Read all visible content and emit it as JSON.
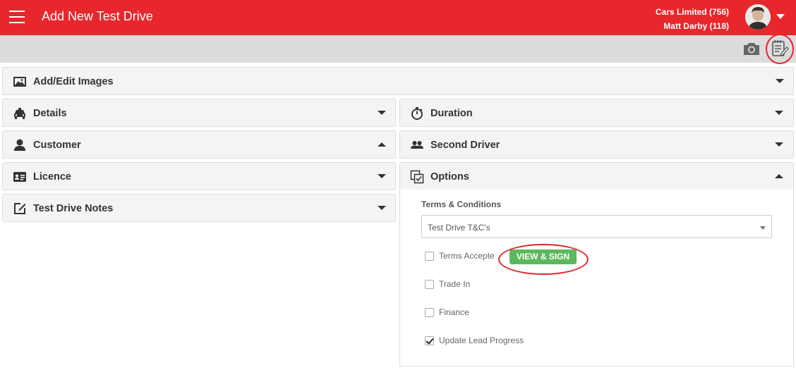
{
  "header": {
    "title": "Add New Test Drive",
    "company": "Cars Limited (756)",
    "user": "Matt Darby (118)"
  },
  "toolbar": {
    "camera_icon": "camera-icon",
    "notes_icon": "notepad-edit-icon"
  },
  "left_panels": [
    {
      "label": "Add/Edit Images",
      "icon": "image-icon",
      "state": "collapsed"
    },
    {
      "label": "Details",
      "icon": "car-icon",
      "state": "collapsed"
    },
    {
      "label": "Customer",
      "icon": "user-icon",
      "state": "expanded"
    },
    {
      "label": "Licence",
      "icon": "id-card-icon",
      "state": "collapsed"
    },
    {
      "label": "Test Drive Notes",
      "icon": "edit-note-icon",
      "state": "collapsed"
    }
  ],
  "right_panels": [
    {
      "label": "Duration",
      "icon": "stopwatch-icon",
      "state": "collapsed"
    },
    {
      "label": "Second Driver",
      "icon": "users-icon",
      "state": "collapsed"
    },
    {
      "label": "Options",
      "icon": "checklist-icon",
      "state": "expanded"
    }
  ],
  "options": {
    "terms_label": "Terms & Conditions",
    "terms_selected": "Test Drive T&C's",
    "view_sign_label": "VIEW & SIGN",
    "checkboxes": [
      {
        "label": "Terms Accepte",
        "checked": false
      },
      {
        "label": "Trade In",
        "checked": false
      },
      {
        "label": "Finance",
        "checked": false
      },
      {
        "label": "Update Lead Progress",
        "checked": true
      }
    ]
  },
  "colors": {
    "brand": "#e8272c",
    "button_green": "#5cb85c",
    "highlight_red": "#e2262b"
  }
}
